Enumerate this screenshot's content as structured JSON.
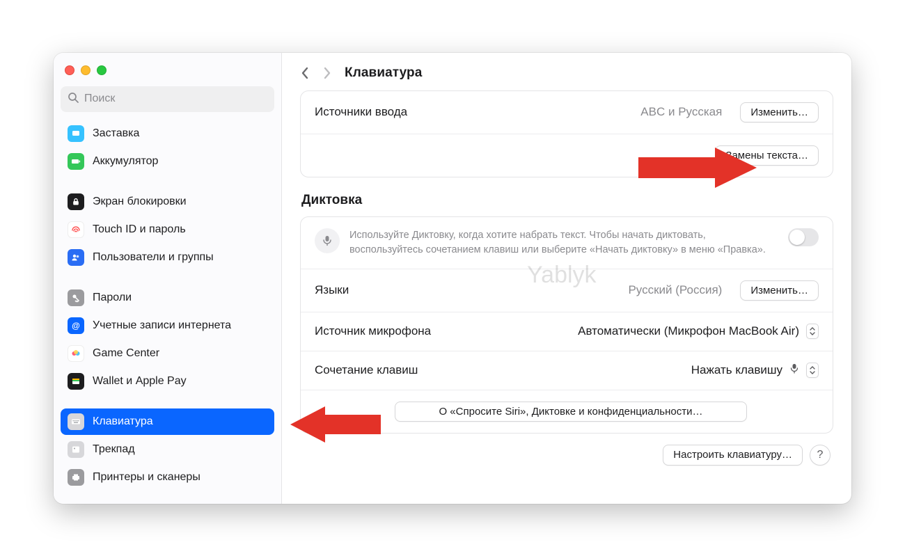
{
  "header": {
    "title": "Клавиатура"
  },
  "search": {
    "placeholder": "Поиск"
  },
  "sidebar": {
    "items": [
      {
        "label": "Заставка",
        "icon": "screensaver-icon",
        "bg": "#36c2ff"
      },
      {
        "label": "Аккумулятор",
        "icon": "battery-icon",
        "bg": "#34c759"
      },
      {
        "label": "Экран блокировки",
        "icon": "lock-icon",
        "bg": "#1d1d1f"
      },
      {
        "label": "Touch ID и пароль",
        "icon": "fingerprint-icon",
        "bg": "#ffffff"
      },
      {
        "label": "Пользователи и группы",
        "icon": "users-icon",
        "bg": "#2a6df4"
      },
      {
        "label": "Пароли",
        "icon": "key-icon",
        "bg": "#9b9b9e"
      },
      {
        "label": "Учетные записи интернета",
        "icon": "at-icon",
        "bg": "#0a66ff"
      },
      {
        "label": "Game Center",
        "icon": "gamecenter-icon",
        "bg": "#ffffff"
      },
      {
        "label": "Wallet и Apple Pay",
        "icon": "wallet-icon",
        "bg": "#1d1d1f"
      },
      {
        "label": "Клавиатура",
        "icon": "keyboard-icon",
        "bg": "#d7d7da"
      },
      {
        "label": "Трекпад",
        "icon": "trackpad-icon",
        "bg": "#d7d7da"
      },
      {
        "label": "Принтеры и сканеры",
        "icon": "printer-icon",
        "bg": "#9b9b9e"
      }
    ],
    "selected_index": 9
  },
  "content": {
    "input_sources": {
      "label": "Источники ввода",
      "value": "ABC и Русская",
      "edit_button": "Изменить…"
    },
    "text_replacement_button": "Замены текста…",
    "dictation": {
      "heading": "Диктовка",
      "note": "Используйте Диктовку, когда хотите набрать текст. Чтобы начать диктовать, воспользуйтесь сочетанием клавиш или выберите «Начать диктовку» в меню «Правка».",
      "languages": {
        "label": "Языки",
        "value": "Русский (Россия)",
        "edit_button": "Изменить…"
      },
      "mic_source": {
        "label": "Источник микрофона",
        "value": "Автоматически (Микрофон MacBook Air)"
      },
      "shortcut": {
        "label": "Сочетание клавиш",
        "value": "Нажать клавишу"
      },
      "siri_button": "О «Спросите Siri», Диктовке и конфиденциальности…"
    },
    "footer": {
      "customize_button": "Настроить клавиатуру…",
      "help_button": "?"
    }
  },
  "watermark": "Yablyk"
}
